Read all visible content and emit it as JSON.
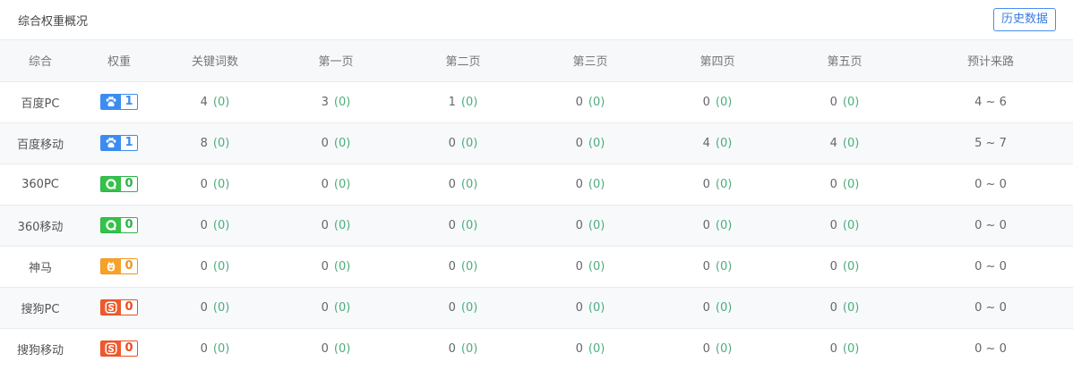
{
  "header": {
    "title": "综合权重概况",
    "history_button": "历史数据"
  },
  "columns": [
    "综合",
    "权重",
    "关键词数",
    "第一页",
    "第二页",
    "第三页",
    "第四页",
    "第五页",
    "预计来路"
  ],
  "rows": [
    {
      "name": "百度PC",
      "engine": "baidu",
      "weight": "1",
      "icon": "baidu-paw-icon",
      "cells": [
        [
          "4",
          "(0)"
        ],
        [
          "3",
          "(0)"
        ],
        [
          "1",
          "(0)"
        ],
        [
          "0",
          "(0)"
        ],
        [
          "0",
          "(0)"
        ],
        [
          "0",
          "(0)"
        ]
      ],
      "predicted": "4 ~ 6"
    },
    {
      "name": "百度移动",
      "engine": "baidu",
      "weight": "1",
      "icon": "baidu-paw-icon",
      "cells": [
        [
          "8",
          "(0)"
        ],
        [
          "0",
          "(0)"
        ],
        [
          "0",
          "(0)"
        ],
        [
          "0",
          "(0)"
        ],
        [
          "4",
          "(0)"
        ],
        [
          "4",
          "(0)"
        ]
      ],
      "predicted": "5 ~ 7"
    },
    {
      "name": "360PC",
      "engine": "360",
      "weight": "0",
      "icon": "360-ring-icon",
      "cells": [
        [
          "0",
          "(0)"
        ],
        [
          "0",
          "(0)"
        ],
        [
          "0",
          "(0)"
        ],
        [
          "0",
          "(0)"
        ],
        [
          "0",
          "(0)"
        ],
        [
          "0",
          "(0)"
        ]
      ],
      "predicted": "0 ~ 0"
    },
    {
      "name": "360移动",
      "engine": "360",
      "weight": "0",
      "icon": "360-ring-icon",
      "cells": [
        [
          "0",
          "(0)"
        ],
        [
          "0",
          "(0)"
        ],
        [
          "0",
          "(0)"
        ],
        [
          "0",
          "(0)"
        ],
        [
          "0",
          "(0)"
        ],
        [
          "0",
          "(0)"
        ]
      ],
      "predicted": "0 ~ 0"
    },
    {
      "name": "神马",
      "engine": "sm",
      "weight": "0",
      "icon": "shenma-horse-icon",
      "cells": [
        [
          "0",
          "(0)"
        ],
        [
          "0",
          "(0)"
        ],
        [
          "0",
          "(0)"
        ],
        [
          "0",
          "(0)"
        ],
        [
          "0",
          "(0)"
        ],
        [
          "0",
          "(0)"
        ]
      ],
      "predicted": "0 ~ 0"
    },
    {
      "name": "搜狗PC",
      "engine": "sogou",
      "weight": "0",
      "icon": "sogou-s-icon",
      "cells": [
        [
          "0",
          "(0)"
        ],
        [
          "0",
          "(0)"
        ],
        [
          "0",
          "(0)"
        ],
        [
          "0",
          "(0)"
        ],
        [
          "0",
          "(0)"
        ],
        [
          "0",
          "(0)"
        ]
      ],
      "predicted": "0 ~ 0"
    },
    {
      "name": "搜狗移动",
      "engine": "sogou",
      "weight": "0",
      "icon": "sogou-s-icon",
      "cells": [
        [
          "0",
          "(0)"
        ],
        [
          "0",
          "(0)"
        ],
        [
          "0",
          "(0)"
        ],
        [
          "0",
          "(0)"
        ],
        [
          "0",
          "(0)"
        ],
        [
          "0",
          "(0)"
        ]
      ],
      "predicted": "0 ~ 0"
    }
  ],
  "colors": {
    "baidu": "#3c8cf0",
    "360": "#29b546",
    "sm": "#f2941c",
    "sogou": "#e94e23",
    "delta": "#4cae7a",
    "accent": "#4b8df0"
  }
}
